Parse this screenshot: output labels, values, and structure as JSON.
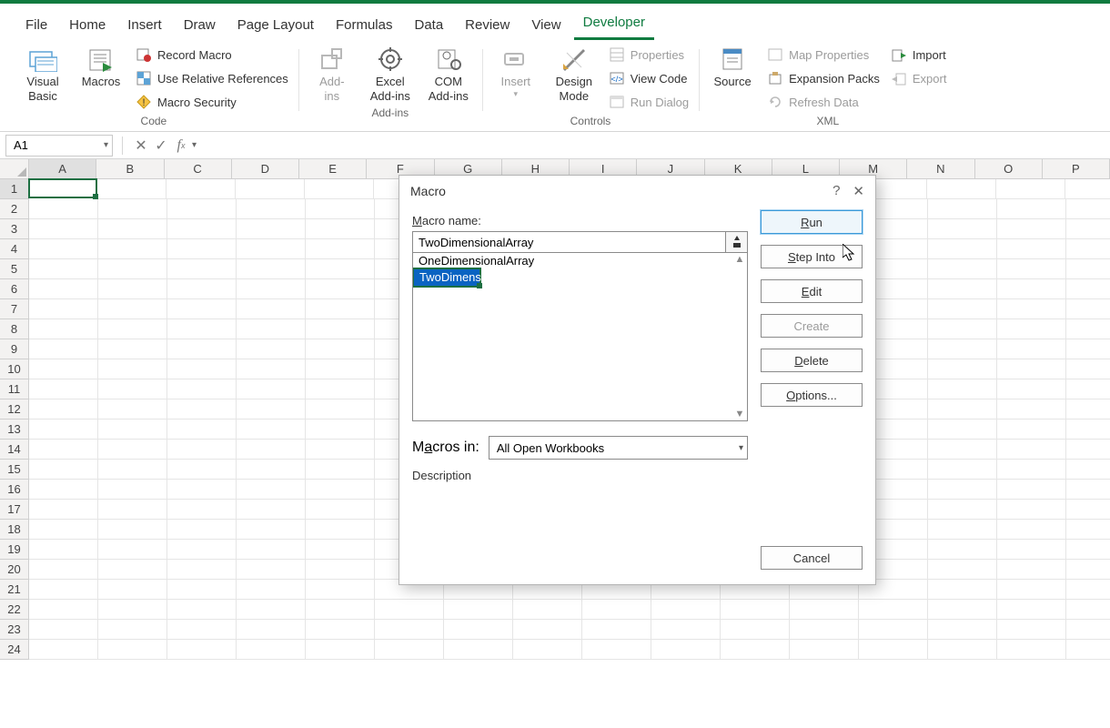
{
  "tabs": [
    "File",
    "Home",
    "Insert",
    "Draw",
    "Page Layout",
    "Formulas",
    "Data",
    "Review",
    "View",
    "Developer"
  ],
  "active_tab": "Developer",
  "ribbon": {
    "group_code": {
      "label": "Code",
      "visual_basic": "Visual\nBasic",
      "macros": "Macros",
      "record_macro": "Record Macro",
      "use_relative": "Use Relative References",
      "macro_security": "Macro Security"
    },
    "group_addins": {
      "label": "Add-ins",
      "addins": "Add-\nins",
      "excel_addins": "Excel\nAdd-ins",
      "com_addins": "COM\nAdd-ins"
    },
    "group_controls": {
      "label": "Controls",
      "insert": "Insert",
      "design_mode": "Design\nMode",
      "properties": "Properties",
      "view_code": "View Code",
      "run_dialog": "Run Dialog"
    },
    "group_xml": {
      "label": "XML",
      "source": "Source",
      "map_props": "Map Properties",
      "expansion": "Expansion Packs",
      "refresh": "Refresh Data",
      "import": "Import",
      "export": "Export"
    }
  },
  "namebox": "A1",
  "columns": [
    "A",
    "B",
    "C",
    "D",
    "E",
    "F",
    "G",
    "H",
    "I",
    "J",
    "K",
    "L",
    "M",
    "N",
    "O",
    "P"
  ],
  "rows": [
    1,
    2,
    3,
    4,
    5,
    6,
    7,
    8,
    9,
    10,
    11,
    12,
    13,
    14,
    15,
    16,
    17,
    18,
    19,
    20,
    21,
    22,
    23,
    24
  ],
  "selected_cell": "A1",
  "dialog": {
    "title": "Macro",
    "name_label": "Macro name:",
    "name_value": "TwoDimensionalArray",
    "list": [
      "OneDimensionalArray",
      "TwoDimensionalArray"
    ],
    "selected_index": 1,
    "macros_in_label": "Macros in:",
    "macros_in_value": "All Open Workbooks",
    "description_label": "Description",
    "buttons": {
      "run": "Run",
      "step_into": "Step Into",
      "edit": "Edit",
      "create": "Create",
      "delete": "Delete",
      "options": "Options...",
      "cancel": "Cancel"
    }
  }
}
